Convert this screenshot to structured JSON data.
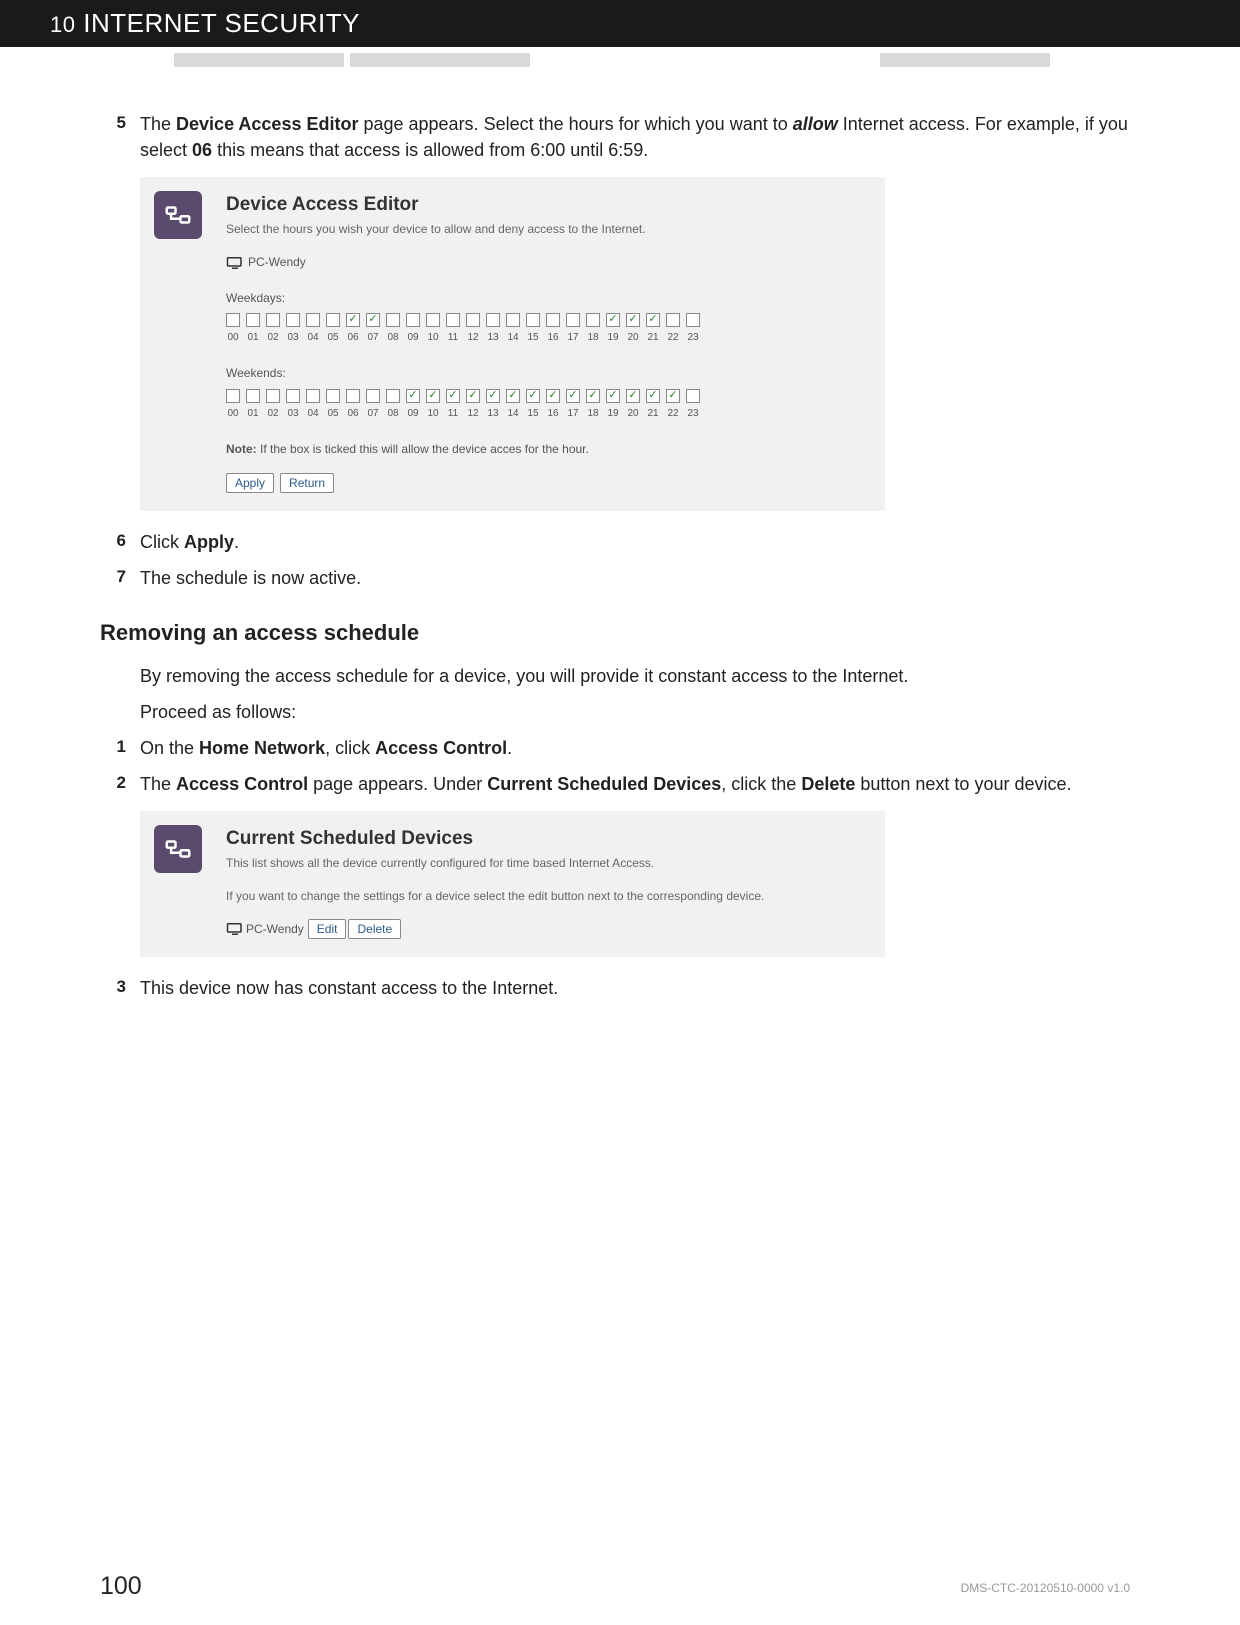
{
  "header": {
    "chapter_num": "10",
    "chapter_title": "INTERNET SECURITY"
  },
  "step5": {
    "num": "5",
    "pre": "The ",
    "bold1": "Device Access Editor",
    "mid1": " page appears. Select the hours for which you want to ",
    "allow": "allow",
    "mid2": " Internet access. For example, if you select ",
    "bold2": "06",
    "post": " this means that access is allowed from 6:00 until 6:59."
  },
  "panel1": {
    "title": "Device Access Editor",
    "subtitle": "Select the hours you wish your device to allow and deny access to the Internet.",
    "device": "PC-Wendy",
    "weekdays_label": "Weekdays:",
    "weekends_label": "Weekends:",
    "hours": [
      "00",
      "01",
      "02",
      "03",
      "04",
      "05",
      "06",
      "07",
      "08",
      "09",
      "10",
      "11",
      "12",
      "13",
      "14",
      "15",
      "16",
      "17",
      "18",
      "19",
      "20",
      "21",
      "22",
      "23"
    ],
    "weekdays_checked": [
      "06",
      "07",
      "19",
      "20",
      "21"
    ],
    "weekends_checked": [
      "09",
      "10",
      "11",
      "12",
      "13",
      "14",
      "15",
      "16",
      "17",
      "18",
      "19",
      "20",
      "21",
      "22"
    ],
    "note_bold": "Note:",
    "note_text": " If the box is ticked this will allow the device acces for the hour.",
    "apply": "Apply",
    "return": "Return"
  },
  "step6": {
    "num": "6",
    "pre": "Click ",
    "bold": "Apply",
    "post": "."
  },
  "step7": {
    "num": "7",
    "text": "The schedule is now active."
  },
  "removing": {
    "heading": "Removing an access schedule",
    "intro": "By removing the access schedule for a device, you will provide it constant access to the Internet.",
    "proceed": "Proceed as follows:"
  },
  "rstep1": {
    "num": "1",
    "pre": "On the ",
    "bold1": "Home Network",
    "mid": ", click ",
    "bold2": "Access Control",
    "post": "."
  },
  "rstep2": {
    "num": "2",
    "pre": "The ",
    "bold1": "Access Control",
    "mid1": " page appears. Under ",
    "bold2": "Current Scheduled Devices",
    "mid2": ", click the ",
    "bold3": "Delete",
    "post": " button next to your device."
  },
  "panel2": {
    "title": "Current Scheduled Devices",
    "subtitle": "This list shows all the device currently configured for time based Internet Access.",
    "desc": "If you want to change the settings for a device select the edit button next to the corresponding device.",
    "device": "PC-Wendy",
    "edit": "Edit",
    "delete": "Delete"
  },
  "rstep3": {
    "num": "3",
    "text": "This device now has constant access to the Internet."
  },
  "footer": {
    "page": "100",
    "doc": "DMS-CTC-20120510-0000 v1.0"
  }
}
